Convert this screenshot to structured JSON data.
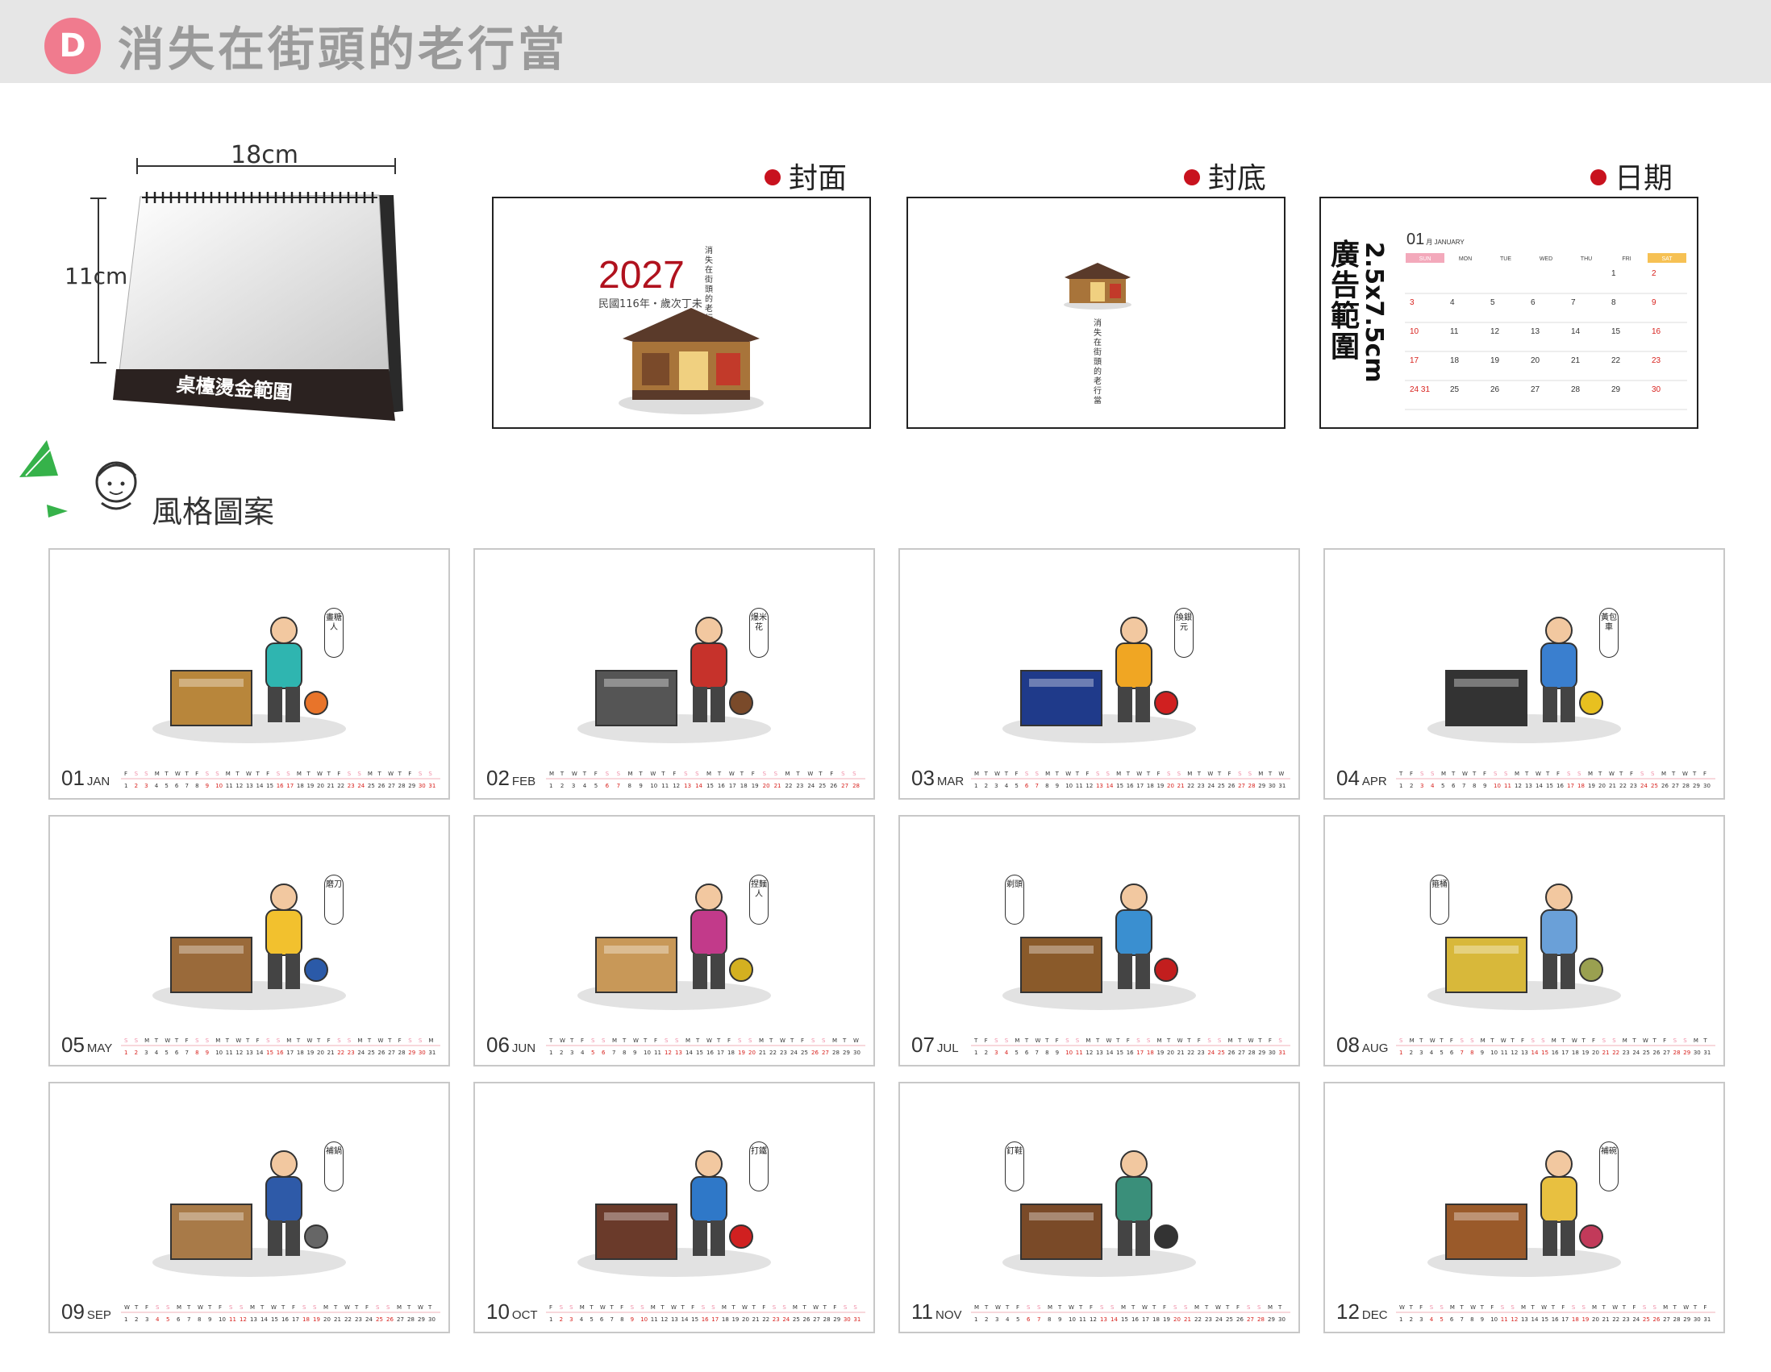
{
  "header": {
    "badge": "D",
    "title": "消失在街頭的老行當"
  },
  "desk": {
    "width_label": "18cm",
    "height_label": "11cm",
    "base_label": "桌檯燙金範圍"
  },
  "sections": {
    "cover": "封面",
    "back": "封底",
    "date": "日期"
  },
  "cover": {
    "year": "2027",
    "subtitle": "民國116年・歲次丁未",
    "vertical_title": "消失在街頭的老行當"
  },
  "back": {
    "vertical_title": "消失在街頭的老行當"
  },
  "date_panel": {
    "ad_label": "廣告範圍",
    "ad_size": "2.5x7.5cm",
    "month_num": "01",
    "month_name": "月 JANUARY",
    "weekdays": [
      "SUN",
      "MON",
      "TUE",
      "WED",
      "THU",
      "FRI",
      "SAT"
    ],
    "weeks": [
      [
        "",
        "",
        "",
        "",
        "",
        "1",
        "2"
      ],
      [
        "3",
        "4",
        "5",
        "6",
        "7",
        "8",
        "9"
      ],
      [
        "10",
        "11",
        "12",
        "13",
        "14",
        "15",
        "16"
      ],
      [
        "17",
        "18",
        "19",
        "20",
        "21",
        "22",
        "23"
      ],
      [
        "24 31",
        "25",
        "26",
        "27",
        "28",
        "29",
        "30"
      ]
    ]
  },
  "styles_title": "風格圖案",
  "months": [
    {
      "num": "01",
      "abbr": "JAN",
      "caption": "畫糖人",
      "days": 31,
      "start": 4
    },
    {
      "num": "02",
      "abbr": "FEB",
      "caption": "爆米花",
      "days": 28,
      "start": 0
    },
    {
      "num": "03",
      "abbr": "MAR",
      "caption": "換銀元",
      "days": 31,
      "start": 0
    },
    {
      "num": "04",
      "abbr": "APR",
      "caption": "黃包車",
      "days": 30,
      "start": 3
    },
    {
      "num": "05",
      "abbr": "MAY",
      "caption": "磨刀",
      "days": 31,
      "start": 5
    },
    {
      "num": "06",
      "abbr": "JUN",
      "caption": "捏麵人",
      "days": 30,
      "start": 1
    },
    {
      "num": "07",
      "abbr": "JUL",
      "caption": "剃頭",
      "days": 31,
      "start": 3
    },
    {
      "num": "08",
      "abbr": "AUG",
      "caption": "箍桶",
      "days": 31,
      "start": 6
    },
    {
      "num": "09",
      "abbr": "SEP",
      "caption": "補鍋",
      "days": 30,
      "start": 2
    },
    {
      "num": "10",
      "abbr": "OCT",
      "caption": "打鐵",
      "days": 31,
      "start": 4
    },
    {
      "num": "11",
      "abbr": "NOV",
      "caption": "釘鞋",
      "days": 30,
      "start": 0
    },
    {
      "num": "12",
      "abbr": "DEC",
      "caption": "補碗",
      "days": 31,
      "start": 2
    }
  ],
  "scenes": [
    {
      "name": "sugar-painter",
      "shirt": "#2fb5b0",
      "prop": "#b8863b",
      "accent": "#e8742a"
    },
    {
      "name": "popcorn-seller",
      "shirt": "#c6322b",
      "prop": "#555555",
      "accent": "#7a4a2a"
    },
    {
      "name": "coin-exchanger",
      "shirt": "#f0a623",
      "prop": "#1f3a8a",
      "accent": "#d02020"
    },
    {
      "name": "rickshaw-puller",
      "shirt": "#3a7fcf",
      "prop": "#333333",
      "accent": "#e8c020"
    },
    {
      "name": "knife-grinder",
      "shirt": "#f2c12e",
      "prop": "#9a6a3a",
      "accent": "#2b5aa8"
    },
    {
      "name": "dough-figure-maker",
      "shirt": "#c23a8a",
      "prop": "#c89858",
      "accent": "#d4b020"
    },
    {
      "name": "street-barber",
      "shirt": "#3a8fd0",
      "prop": "#8a5a2a",
      "accent": "#c21e1e"
    },
    {
      "name": "basket-weaver",
      "shirt": "#6aa0d8",
      "prop": "#d8b83a",
      "accent": "#9aa050"
    },
    {
      "name": "pot-mender",
      "shirt": "#2e5aa8",
      "prop": "#a87a48",
      "accent": "#666666"
    },
    {
      "name": "blacksmith",
      "shirt": "#2f78c8",
      "prop": "#6a3a2a",
      "accent": "#d02020"
    },
    {
      "name": "cobbler",
      "shirt": "#3a8f7a",
      "prop": "#7a4a28",
      "accent": "#333333"
    },
    {
      "name": "bowl-mender",
      "shirt": "#e8c040",
      "prop": "#9a5a2a",
      "accent": "#c23a5a"
    }
  ],
  "colors": {
    "weekend_red": "#d8221e",
    "weekend_pink": "#f090a8",
    "badge": "#f07b8e",
    "header_bg": "#e6e6e6",
    "dot": "#c8121e"
  }
}
